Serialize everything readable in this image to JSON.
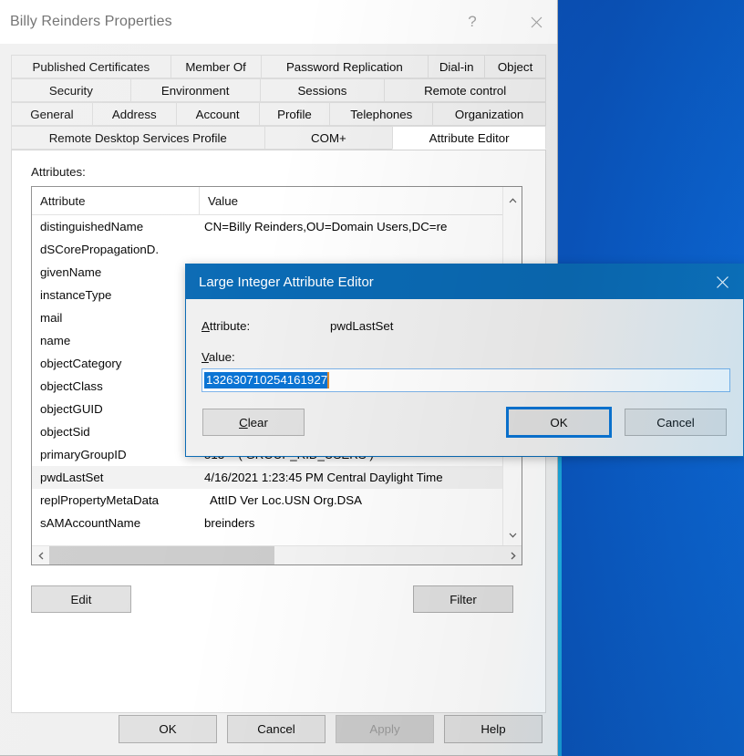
{
  "window": {
    "title": "Billy Reinders Properties",
    "help_icon": "?",
    "close_icon": "close-icon"
  },
  "tabs": {
    "rows": [
      [
        "Published Certificates",
        "Member Of",
        "Password Replication",
        "Dial-in",
        "Object"
      ],
      [
        "Security",
        "Environment",
        "Sessions",
        "Remote control"
      ],
      [
        "General",
        "Address",
        "Account",
        "Profile",
        "Telephones",
        "Organization"
      ],
      [
        "Remote Desktop Services Profile",
        "COM+",
        "Attribute Editor"
      ]
    ],
    "selected": "Attribute Editor"
  },
  "attribute_editor": {
    "label": "Attributes:",
    "columns": [
      "Attribute",
      "Value"
    ],
    "rows": [
      {
        "attribute": "distinguishedName",
        "value": "CN=Billy Reinders,OU=Domain Users,DC=re",
        "selected": false
      },
      {
        "attribute": "dSCorePropagationD.",
        "value": "",
        "selected": false
      },
      {
        "attribute": "givenName",
        "value": "",
        "selected": false
      },
      {
        "attribute": "instanceType",
        "value": "",
        "selected": false
      },
      {
        "attribute": "mail",
        "value": "",
        "selected": false
      },
      {
        "attribute": "name",
        "value": "",
        "selected": false
      },
      {
        "attribute": "objectCategory",
        "value": "",
        "selected": false
      },
      {
        "attribute": "objectClass",
        "value": "",
        "selected": false
      },
      {
        "attribute": "objectGUID",
        "value": "",
        "selected": false
      },
      {
        "attribute": "objectSid",
        "value": "",
        "selected": false
      },
      {
        "attribute": "primaryGroupID",
        "value": "513 = ( GROUP_RID_USERS )",
        "selected": false
      },
      {
        "attribute": "pwdLastSet",
        "value": "4/16/2021 1:23:45 PM Central Daylight Time",
        "selected": true
      },
      {
        "attribute": "replPropertyMetaData",
        "value": "AttID  Ver    Loc.USN                 Org.DSA",
        "selected": false
      },
      {
        "attribute": "sAMAccountName",
        "value": "breinders",
        "selected": false
      }
    ],
    "scroll_up_icon": "chevron-up-icon",
    "scroll_down_icon": "chevron-down-icon",
    "scroll_left_icon": "chevron-left-icon",
    "scroll_right_icon": "chevron-right-icon",
    "edit_button": "Edit",
    "filter_button": "Filter"
  },
  "footer": {
    "ok": "OK",
    "cancel": "Cancel",
    "apply": "Apply",
    "help": "Help"
  },
  "dialog": {
    "title": "Large Integer Attribute Editor",
    "close_icon": "close-icon",
    "attribute_label": "Attribute:",
    "attribute_value": "pwdLastSet",
    "value_label": "Value:",
    "value": "132630710254161927",
    "clear_button": "Clear",
    "ok_button": "OK",
    "cancel_button": "Cancel"
  },
  "colors": {
    "dialog_title_bg": "#0a6ab4",
    "selection_blue": "#0a74d4",
    "focus_blue": "#0a74d4",
    "desktop_blue": "#0c55c4"
  }
}
